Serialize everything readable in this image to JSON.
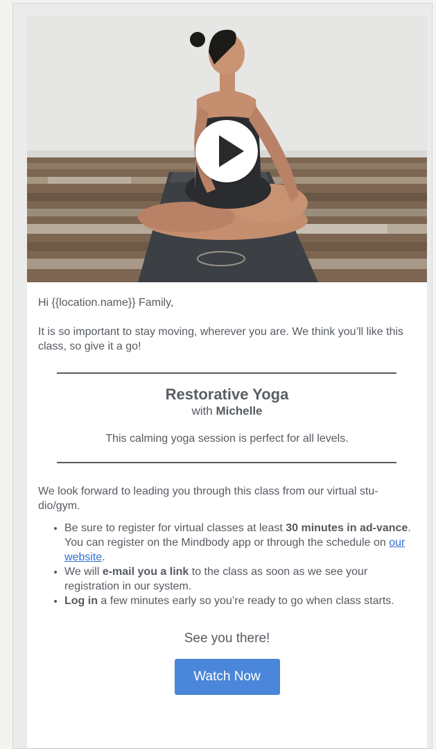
{
  "email": {
    "greeting": "Hi {{location.name}} Family,",
    "intro": "It is so important to stay moving, wherever you are. We think you’ll like this class, so give it a go!",
    "class": {
      "title": "Restorative Yoga",
      "with_prefix": "with",
      "instructor": "Michelle",
      "description": "This calming yoga session is perfect for all levels."
    },
    "forward_text": "We look forward to leading you through this class from our virtual stu-dio/gym.",
    "tips": [
      {
        "pre": "Be sure to register for virtual classes at least ",
        "bold": "30 minutes in ad-vance",
        "post": ". You can register on the Mindbody app or through the schedule on ",
        "link": "our website",
        "end": "."
      },
      {
        "pre": "We will ",
        "bold": "e-mail you a link",
        "post": " to the class as soon as we see your registration in our system."
      },
      {
        "bold": "Log in",
        "post": " a few minutes early so you’re ready to go when class starts."
      }
    ],
    "closing": "See you there!",
    "cta_label": "Watch Now"
  },
  "colors": {
    "cta": "#4a86d9",
    "link": "#2f6fd3",
    "text": "#555a60"
  },
  "icons": {
    "video_play": "play-icon"
  }
}
